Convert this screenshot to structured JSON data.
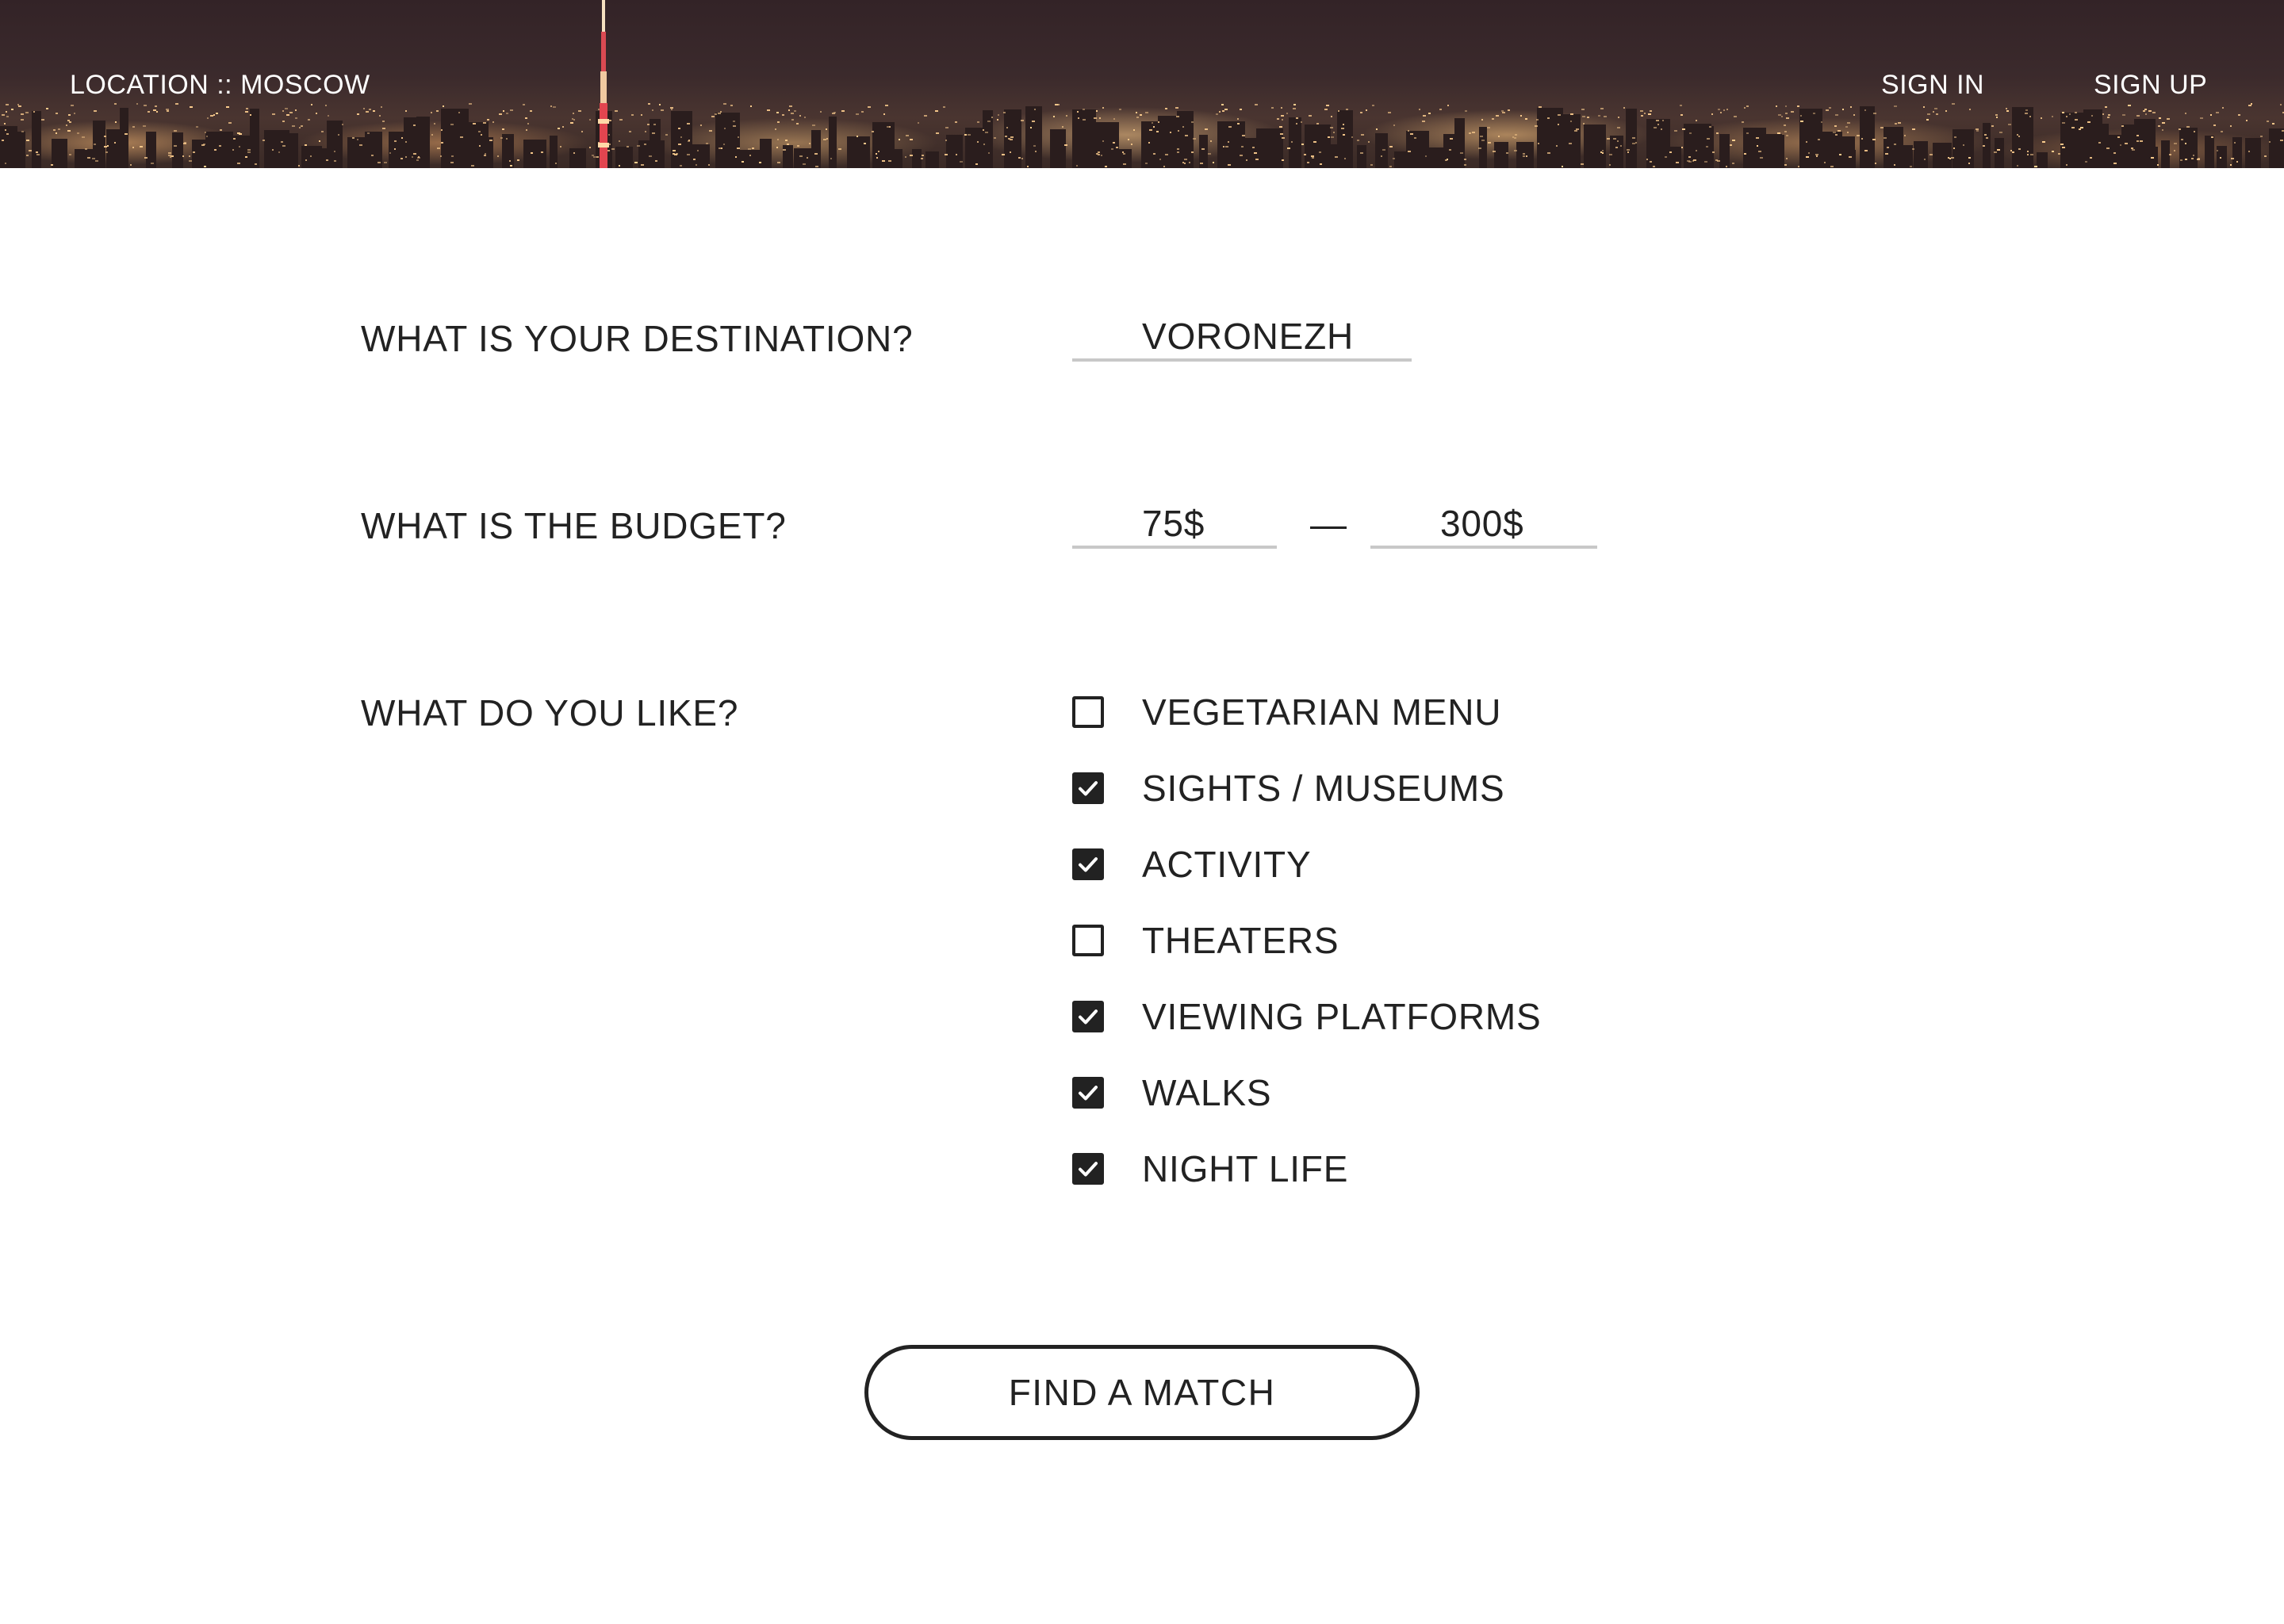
{
  "header": {
    "location_text": "LOCATION :: MOSCOW",
    "sign_in": "SIGN IN",
    "sign_up": "SIGN UP"
  },
  "form": {
    "destination": {
      "label": "WHAT IS YOUR DESTINATION?",
      "value": "VORONEZH"
    },
    "budget": {
      "label": "WHAT IS THE BUDGET?",
      "min_value": "75$",
      "separator": "—",
      "max_value": "300$"
    },
    "likes": {
      "label": "WHAT DO YOU LIKE?",
      "options": [
        {
          "label": "VEGETARIAN MENU",
          "checked": false
        },
        {
          "label": "SIGHTS / MUSEUMS",
          "checked": true
        },
        {
          "label": "ACTIVITY",
          "checked": true
        },
        {
          "label": "THEATERS",
          "checked": false
        },
        {
          "label": "VIEWING PLATFORMS",
          "checked": true
        },
        {
          "label": "WALKS",
          "checked": true
        },
        {
          "label": "NIGHT LIFE",
          "checked": true
        }
      ]
    },
    "submit_label": "FIND A MATCH"
  },
  "colors": {
    "text": "#222222",
    "underline": "#c8c8c8",
    "header_bg": "#3b2a2c",
    "city_lights": "#ffc98a",
    "tower": "#e2454f"
  }
}
